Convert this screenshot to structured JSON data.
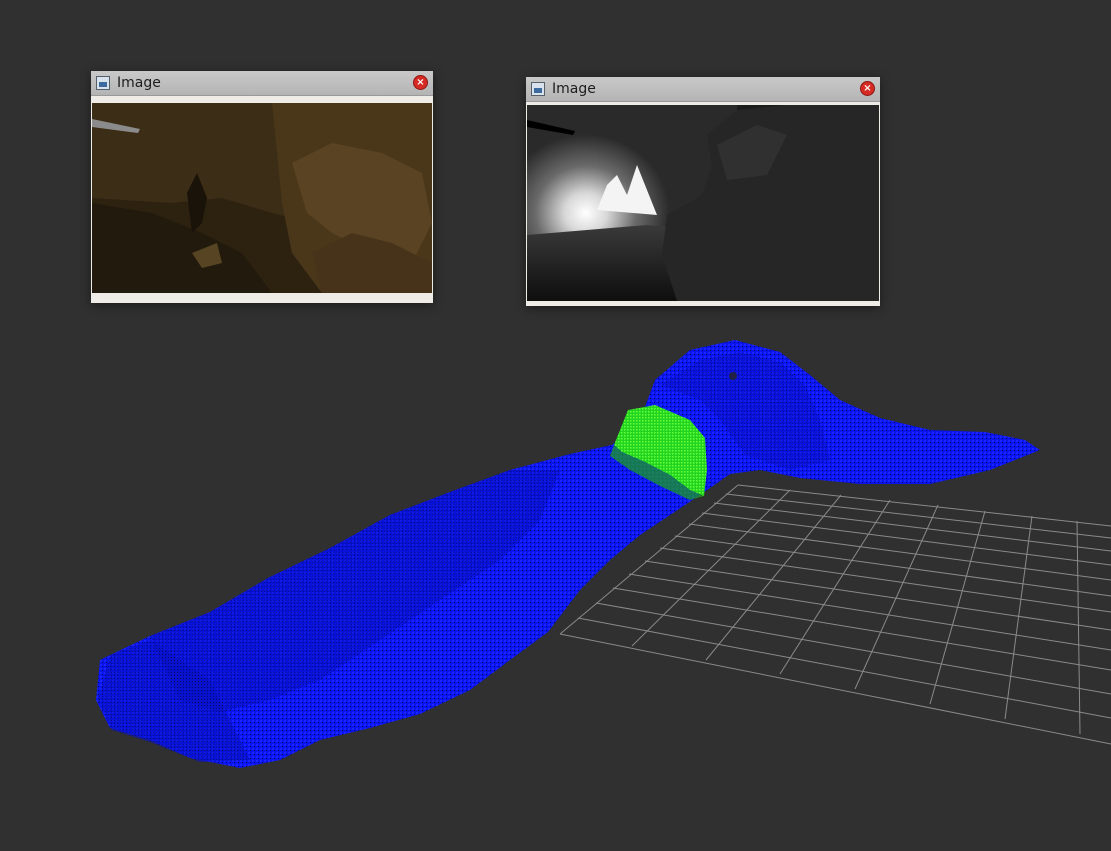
{
  "windows": [
    {
      "title": "Image",
      "view": "rgb-camera",
      "close_glyph": "×"
    },
    {
      "title": "Image",
      "view": "depth-camera",
      "close_glyph": "×"
    }
  ],
  "scene": {
    "background": "#303030",
    "grid_color": "#a0a0a0",
    "pointcloud_colors": {
      "main": "#0a14ff",
      "near": "#24e01f"
    }
  },
  "icons": {
    "window_icon": "image-icon",
    "close_icon": "close-icon"
  }
}
